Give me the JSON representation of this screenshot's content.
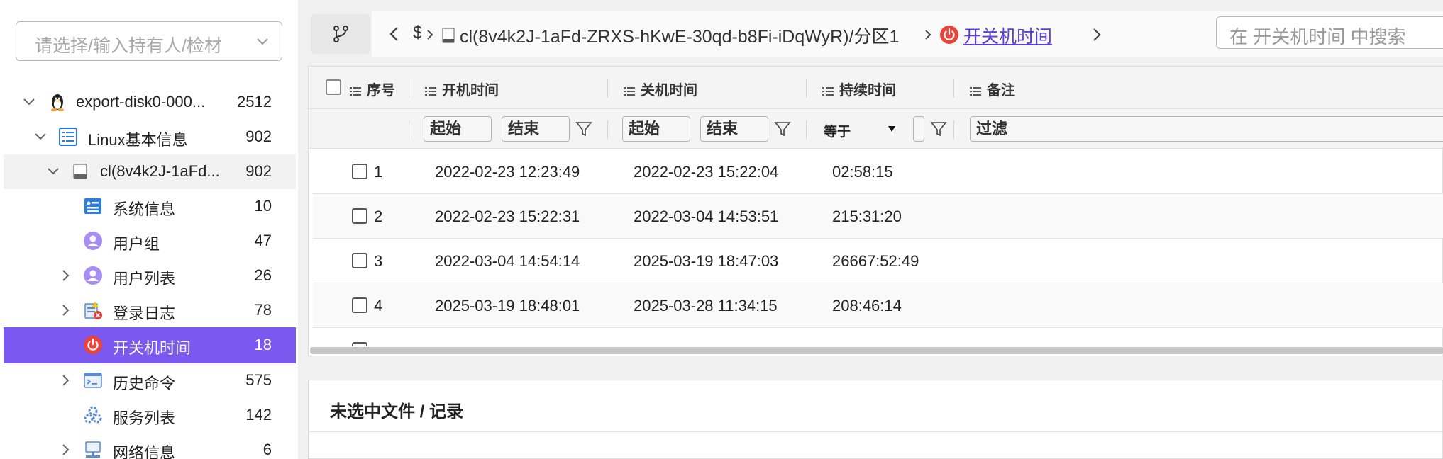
{
  "owner_select": {
    "placeholder": "请选择/输入持有人/检材"
  },
  "tree": [
    {
      "label": "export-disk0-000...",
      "count": "2512",
      "icon": "linux-penguin-icon"
    },
    {
      "label": "Linux基本信息",
      "count": "902",
      "icon": "list-icon"
    },
    {
      "label": "cl(8v4k2J-1aFd...",
      "count": "902",
      "icon": "disk-icon"
    },
    {
      "label": "系统信息",
      "count": "10",
      "icon": "system-info-icon"
    },
    {
      "label": "用户组",
      "count": "47",
      "icon": "user-group-icon"
    },
    {
      "label": "用户列表",
      "count": "26",
      "icon": "user-list-icon"
    },
    {
      "label": "登录日志",
      "count": "78",
      "icon": "login-log-icon"
    },
    {
      "label": "开关机时间",
      "count": "18",
      "icon": "power-icon",
      "selected": true
    },
    {
      "label": "历史命令",
      "count": "575",
      "icon": "terminal-icon"
    },
    {
      "label": "服务列表",
      "count": "142",
      "icon": "services-icon"
    },
    {
      "label": "网络信息",
      "count": "6",
      "icon": "network-icon"
    }
  ],
  "breadcrumb": {
    "truncated": "$",
    "disk": "cl(8v4k2J-1aFd-ZRXS-hKwE-30qd-b8Fi-iDqWyR)/分区1",
    "current": "开关机时间"
  },
  "search": {
    "placeholder": "在 开关机时间 中搜索"
  },
  "table": {
    "columns": [
      "序号",
      "开机时间",
      "关机时间",
      "持续时间",
      "备注"
    ],
    "filters": {
      "start_placeholder": "起始",
      "end_placeholder": "结束",
      "duration_op": "等于",
      "note_placeholder": "过滤"
    },
    "rows": [
      {
        "no": "1",
        "boot": "2022-02-23 12:23:49",
        "shutdown": "2022-02-23 15:22:04",
        "duration": "02:58:15",
        "note": ""
      },
      {
        "no": "2",
        "boot": "2022-02-23 15:22:31",
        "shutdown": "2022-03-04 14:53:51",
        "duration": "215:31:20",
        "note": ""
      },
      {
        "no": "3",
        "boot": "2022-03-04 14:54:14",
        "shutdown": "2025-03-19 18:47:03",
        "duration": "26667:52:49",
        "note": ""
      },
      {
        "no": "4",
        "boot": "2025-03-19 18:48:01",
        "shutdown": "2025-03-28 11:34:15",
        "duration": "208:46:14",
        "note": ""
      }
    ]
  },
  "detail": {
    "title": "未选中文件 / 记录"
  },
  "colors": {
    "accent": "#7b59f0",
    "power_red": "#e8443a"
  }
}
